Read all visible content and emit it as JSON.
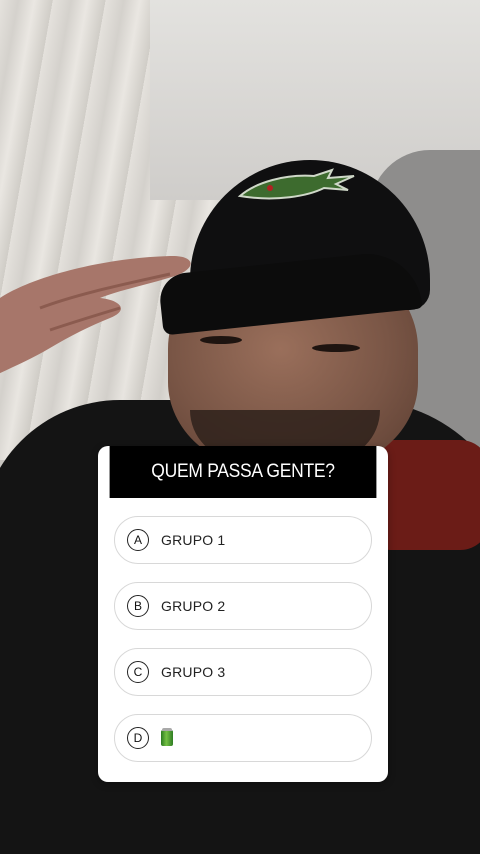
{
  "poll": {
    "question": "QUEM PASSA GENTE?",
    "options": [
      {
        "letter": "A",
        "label": "GRUPO 1"
      },
      {
        "letter": "B",
        "label": "GRUPO 2"
      },
      {
        "letter": "C",
        "label": "GRUPO 3"
      },
      {
        "letter": "D",
        "label": "",
        "icon": "green-can-emoji"
      }
    ]
  },
  "colors": {
    "header_bg": "#000000",
    "card_bg": "#ffffff",
    "option_border": "#d8d8d8"
  }
}
